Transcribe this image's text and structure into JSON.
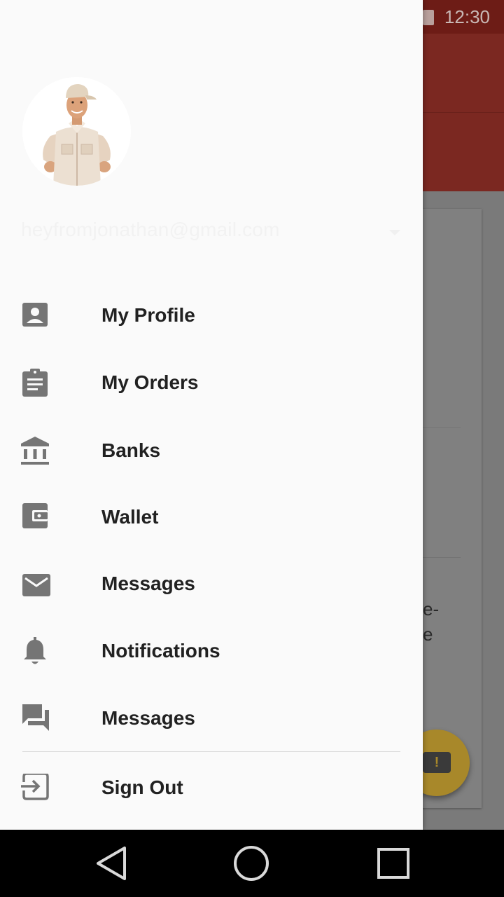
{
  "status_bar": {
    "time": "12:30"
  },
  "drawer": {
    "account": {
      "email": "heyfromjonathan@gmail.com"
    },
    "menu": [
      {
        "label": "My Profile",
        "icon": "account-box-icon"
      },
      {
        "label": "My Orders",
        "icon": "assignment-icon"
      },
      {
        "label": "Banks",
        "icon": "bank-icon"
      },
      {
        "label": "Wallet",
        "icon": "wallet-icon"
      },
      {
        "label": "Messages",
        "icon": "email-icon"
      },
      {
        "label": "Notifications",
        "icon": "bell-icon"
      },
      {
        "label": "Messages",
        "icon": "forum-icon"
      },
      {
        "label": "Sign Out",
        "icon": "exit-icon"
      }
    ]
  },
  "background": {
    "card_text_lines": [
      "e-",
      "e"
    ]
  },
  "colors": {
    "primary": "#b93a2f",
    "accent": "#ffc107",
    "icon": "#757575",
    "text": "#212121"
  },
  "navigation_bar": {
    "buttons": [
      "back-icon",
      "home-icon",
      "recents-icon"
    ]
  }
}
